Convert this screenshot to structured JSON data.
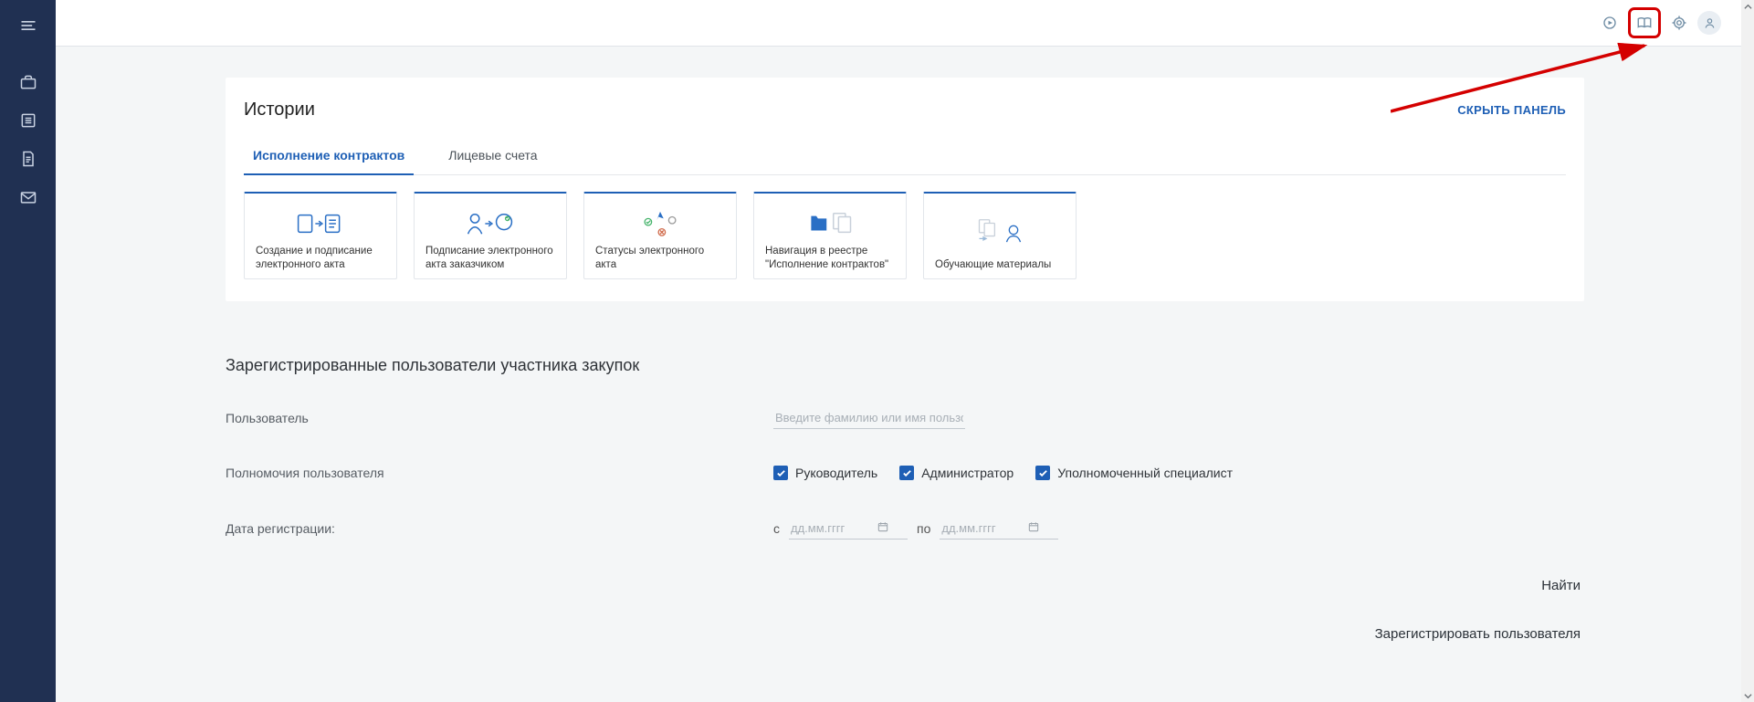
{
  "sidebar": {
    "nav": [
      {
        "name": "briefcase-icon"
      },
      {
        "name": "list-icon"
      },
      {
        "name": "document-icon"
      },
      {
        "name": "mail-icon"
      }
    ]
  },
  "topbar": {
    "icons": [
      {
        "name": "refresh-icon"
      },
      {
        "name": "book-icon",
        "highlighted": true
      },
      {
        "name": "target-icon"
      },
      {
        "name": "user-icon"
      }
    ]
  },
  "histories_panel": {
    "title": "Истории",
    "toggle_label": "СКРЫТЬ ПАНЕЛЬ",
    "tabs": [
      {
        "label": "Исполнение контрактов",
        "active": true
      },
      {
        "label": "Лицевые счета",
        "active": false
      }
    ],
    "cards": [
      {
        "label": "Создание и подписание электронного акта"
      },
      {
        "label": "Подписание электронного акта заказчиком"
      },
      {
        "label": "Статусы электронного акта"
      },
      {
        "label": "Навигация в реестре \"Исполнение контрактов\""
      },
      {
        "label": "Обучающие материалы"
      }
    ]
  },
  "users_section": {
    "title": "Зарегистрированные пользователи участника закупок",
    "user_label": "Пользователь",
    "user_placeholder": "Введите фамилию или имя пользователя",
    "perms_label": "Полномочия пользователя",
    "perms": [
      {
        "label": "Руководитель",
        "checked": true
      },
      {
        "label": "Администратор",
        "checked": true
      },
      {
        "label": "Уполномоченный специалист",
        "checked": true
      }
    ],
    "date_label": "Дата регистрации:",
    "date_from_label": "с",
    "date_to_label": "по",
    "date_placeholder": "дд.мм.гггг",
    "search_label": "Найти",
    "register_label": "Зарегистрировать пользователя"
  }
}
